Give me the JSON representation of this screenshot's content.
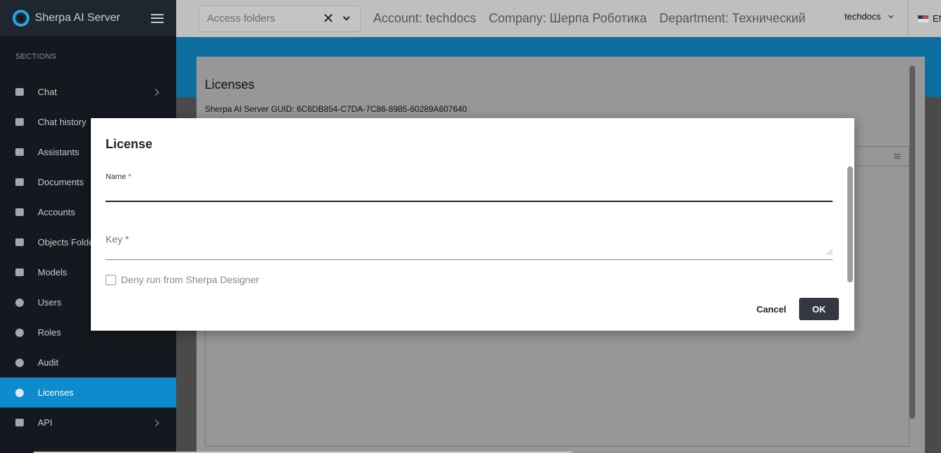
{
  "app": {
    "title": "Sherpa AI Server"
  },
  "sidebar": {
    "section_title": "SECTIONS",
    "items": [
      {
        "label": "Chat"
      },
      {
        "label": "Chat history"
      },
      {
        "label": "Assistants"
      },
      {
        "label": "Documents"
      },
      {
        "label": "Accounts"
      },
      {
        "label": "Objects Folders"
      },
      {
        "label": "Models"
      },
      {
        "label": "Users"
      },
      {
        "label": "Roles"
      },
      {
        "label": "Audit"
      },
      {
        "label": "Licenses"
      },
      {
        "label": "API"
      }
    ]
  },
  "topbar": {
    "folders_placeholder": "Access folders",
    "account": "Account: techdocs",
    "company": "Company: Шерпа Роботика",
    "department": "Department: Технический",
    "user": "techdocs",
    "language": "EN"
  },
  "page": {
    "title": "Licenses",
    "guid": "Sherpa AI Server GUID: 6C6DB854-C7DA-7C86-8985-60289A607640"
  },
  "dialog": {
    "title": "License",
    "name_label": "Name",
    "required_mark": "*",
    "key_label": "Key *",
    "deny_label": "Deny run from Sherpa Designer",
    "cancel_label": "Cancel",
    "ok_label": "OK"
  }
}
